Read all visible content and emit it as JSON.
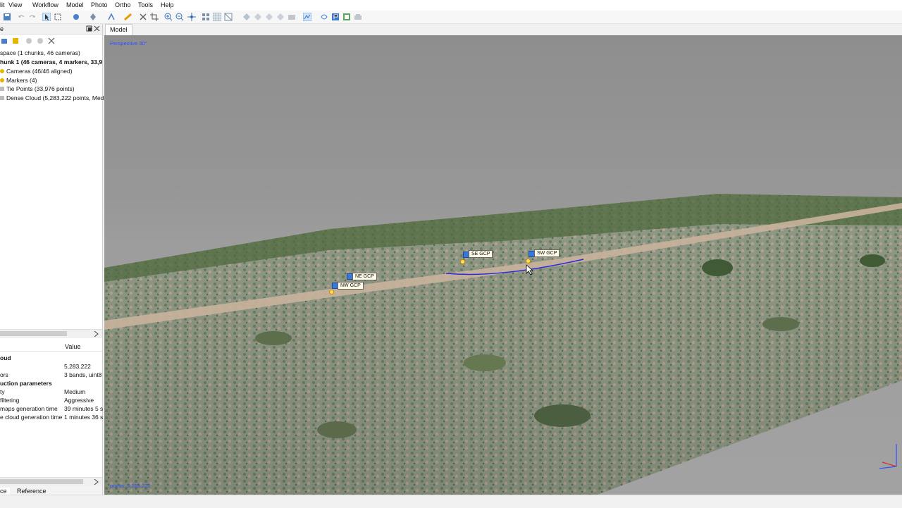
{
  "menubar": {
    "items": [
      "lit",
      "View",
      "Workflow",
      "Model",
      "Photo",
      "Ortho",
      "Tools",
      "Help"
    ]
  },
  "workspace": {
    "dock_label": "e",
    "tree": [
      "space (1 chunks, 46 cameras)",
      "hunk 1 (46 cameras, 4 markers, 33,9",
      "Cameras (46/46 aligned)",
      "Markers (4)",
      "Tie Points (33,976 points)",
      "Dense Cloud (5,283,222 points, Med"
    ]
  },
  "properties": {
    "header_value": "Value",
    "section_title": "oud",
    "rows": [
      {
        "name": "",
        "value": "5,283,222"
      },
      {
        "name": "ors",
        "value": "3 bands, uint8"
      },
      {
        "name": "uction parameters",
        "value": ""
      },
      {
        "name": "ty",
        "value": "Medium"
      },
      {
        "name": "filtering",
        "value": "Aggressive"
      },
      {
        "name": "maps generation time",
        "value": "39 minutes 5 s"
      },
      {
        "name": "e cloud generation time",
        "value": "1 minutes 36 s"
      }
    ]
  },
  "bottom_tabs": [
    "ce",
    "Reference"
  ],
  "view_tab": "Model",
  "viewport": {
    "perspective_label": "Perspective 30°",
    "points_label": "points: 5,283,222",
    "markers": [
      "SE GCP",
      "SW GCP",
      "NE GCP",
      "NW GCP"
    ]
  },
  "colors": {
    "marker_flag": "#3a78d8",
    "selection_line": "#2a2ae0",
    "viewport_label": "#3050ff"
  },
  "icons": [
    "save-icon",
    "undo-icon",
    "redo-icon",
    "select-icon",
    "rectangle-select-icon",
    "navigate-icon",
    "marker-icon",
    "ruler-icon",
    "delete-icon",
    "crop-icon",
    "zoom-in-icon",
    "zoom-out-icon",
    "move-icon",
    "grid-icon",
    "texture-icon",
    "rotate-icon",
    "camera-icon",
    "dense-cloud-icon",
    "shaded-icon",
    "show-markers-icon"
  ]
}
